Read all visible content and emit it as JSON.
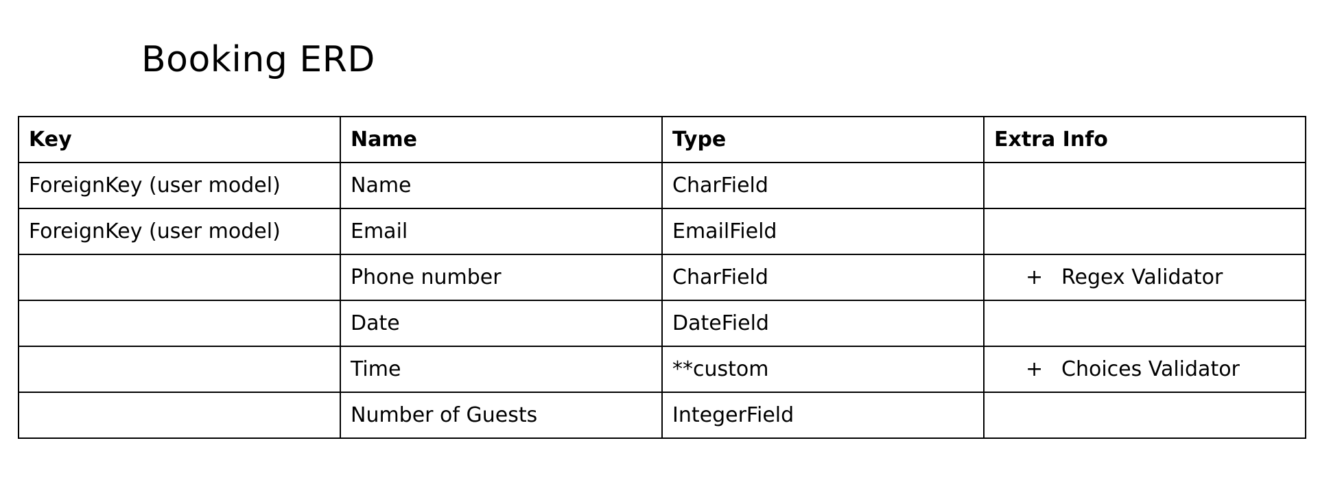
{
  "title": "Booking ERD",
  "table": {
    "headers": [
      "Key",
      "Name",
      "Type",
      "Extra Info"
    ],
    "rows": [
      {
        "key": "ForeignKey (user model)",
        "name": "Name",
        "type": "CharField",
        "extra": ""
      },
      {
        "key": "ForeignKey (user model)",
        "name": "Email",
        "type": "EmailField",
        "extra": ""
      },
      {
        "key": "",
        "name": "Phone number",
        "type": "CharField",
        "extra_bullet": "+",
        "extra": "Regex Validator"
      },
      {
        "key": "",
        "name": "Date",
        "type": "DateField",
        "extra": ""
      },
      {
        "key": "",
        "name": "Time",
        "type": "**custom",
        "extra_bullet": "+",
        "extra": "Choices Validator"
      },
      {
        "key": "",
        "name": "Number of Guests",
        "type": "IntegerField",
        "extra": ""
      }
    ]
  }
}
